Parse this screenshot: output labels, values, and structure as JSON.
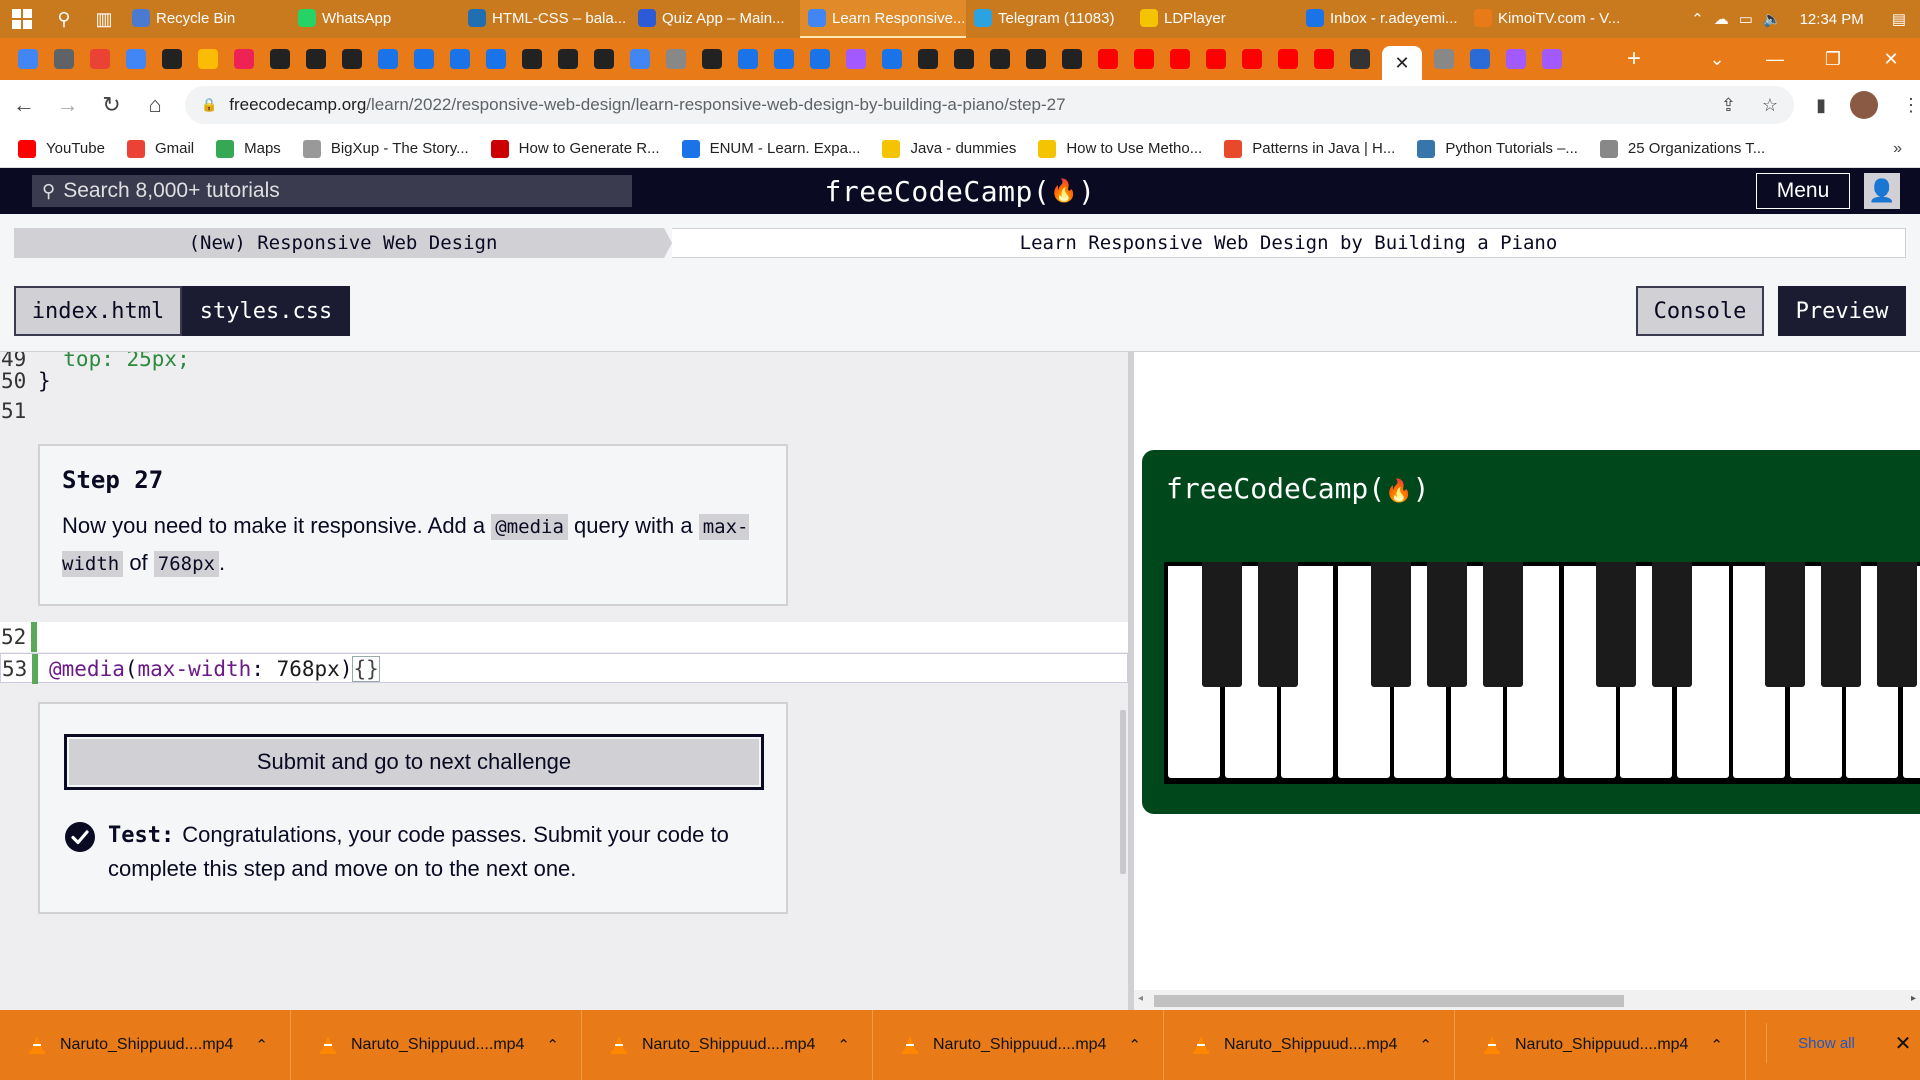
{
  "taskbar": {
    "tasks": [
      {
        "label": "Recycle Bin",
        "color": "#4a7bd0"
      },
      {
        "label": "WhatsApp",
        "color": "#25d366"
      },
      {
        "label": "HTML-CSS – bala...",
        "color": "#1f6fb2"
      },
      {
        "label": "Quiz App – Main...",
        "color": "#2b5bd7"
      },
      {
        "label": "Learn Responsive...",
        "color": "#4285f4"
      },
      {
        "label": "Telegram (11083)",
        "color": "#2aa3e0"
      },
      {
        "label": "LDPlayer",
        "color": "#f5c400"
      },
      {
        "label": "Inbox - r.adeyemi...",
        "color": "#1a73e8"
      },
      {
        "label": "KimoiTV.com - V...",
        "color": "#e87b17"
      }
    ],
    "active_task_index": 4,
    "clock": "12:34 PM"
  },
  "browser": {
    "url_host": "freecodecamp.org",
    "url_path": "/learn/2022/responsive-web-design/learn-responsive-web-design-by-building-a-piano/step-27",
    "favicon_colors": [
      "#4285f4",
      "#5f6368",
      "#ea4335",
      "#4285f4",
      "#222",
      "#fbbc05",
      "#e25",
      "#222",
      "#222",
      "#222",
      "#1a73e8",
      "#1a73e8",
      "#1a73e8",
      "#1a73e8",
      "#222",
      "#222",
      "#222",
      "#4285f4",
      "#888",
      "#222",
      "#1a73e8",
      "#1a73e8",
      "#1a73e8",
      "#a259ff",
      "#1a73e8",
      "#222",
      "#222",
      "#222",
      "#222",
      "#222",
      "#ff0000",
      "#ff0000",
      "#ff0000",
      "#ff0000",
      "#ff0000",
      "#ff0000",
      "#ff0000",
      "#333"
    ],
    "trailing_favicons": [
      "#888",
      "#2a6bd8",
      "#a259ff",
      "#a259ff",
      "#e87b17"
    ]
  },
  "bookmarks": [
    {
      "label": "YouTube",
      "color": "#ff0000"
    },
    {
      "label": "Gmail",
      "color": "#ea4335"
    },
    {
      "label": "Maps",
      "color": "#34a853"
    },
    {
      "label": "BigXup - The Story...",
      "color": "#999"
    },
    {
      "label": "How to Generate R...",
      "color": "#cc0000"
    },
    {
      "label": "ENUM - Learn. Expa...",
      "color": "#1a73e8"
    },
    {
      "label": "Java - dummies",
      "color": "#f5c400"
    },
    {
      "label": "How to Use Metho...",
      "color": "#f5c400"
    },
    {
      "label": "Patterns in Java | H...",
      "color": "#e8492a"
    },
    {
      "label": "Python Tutorials –...",
      "color": "#3776ab"
    },
    {
      "label": "25 Organizations T...",
      "color": "#888"
    }
  ],
  "bookmarks_more": "»",
  "fcc": {
    "search_placeholder": "Search 8,000+ tutorials",
    "logo": "freeCodeCamp(🔥)",
    "logo_text": "freeCodeCamp",
    "menu": "Menu"
  },
  "breadcrumb": {
    "superblock": "(New) Responsive Web Design",
    "block": "Learn Responsive Web Design by Building a Piano"
  },
  "editor_tabs": {
    "index": "index.html",
    "styles": "styles.css",
    "console": "Console",
    "preview": "Preview"
  },
  "code": {
    "line_49_num": "49",
    "line_49_text": "  top: 25px;",
    "line_50_num": "50",
    "line_50_text": "}",
    "line_51_num": "51",
    "line_52_num": "52",
    "line_53_num": "53",
    "line_53_at": "@media",
    "line_53_open": "(",
    "line_53_prop": "max-width",
    "line_53_colon": ": ",
    "line_53_value": "768px",
    "line_53_close": ")",
    "line_53_braces": "{}"
  },
  "step": {
    "title": "Step 27",
    "desc_1": "Now you need to make it responsive. Add a ",
    "code_1": "@media",
    "desc_2": " query with a ",
    "code_2": "max-width",
    "desc_3": " of ",
    "code_3": "768px",
    "desc_4": "."
  },
  "submit": {
    "button": "Submit and go to next challenge",
    "test_label": "Test:",
    "test_text": "Congratulations, your code passes. Submit your code to complete this step and move on to the next one."
  },
  "downloads": {
    "items": [
      "Naruto_Shippuud....mp4",
      "Naruto_Shippuud....mp4",
      "Naruto_Shippuud....mp4",
      "Naruto_Shippuud....mp4",
      "Naruto_Shippuud....mp4",
      "Naruto_Shippuud....mp4"
    ],
    "show_all": "Show all"
  }
}
